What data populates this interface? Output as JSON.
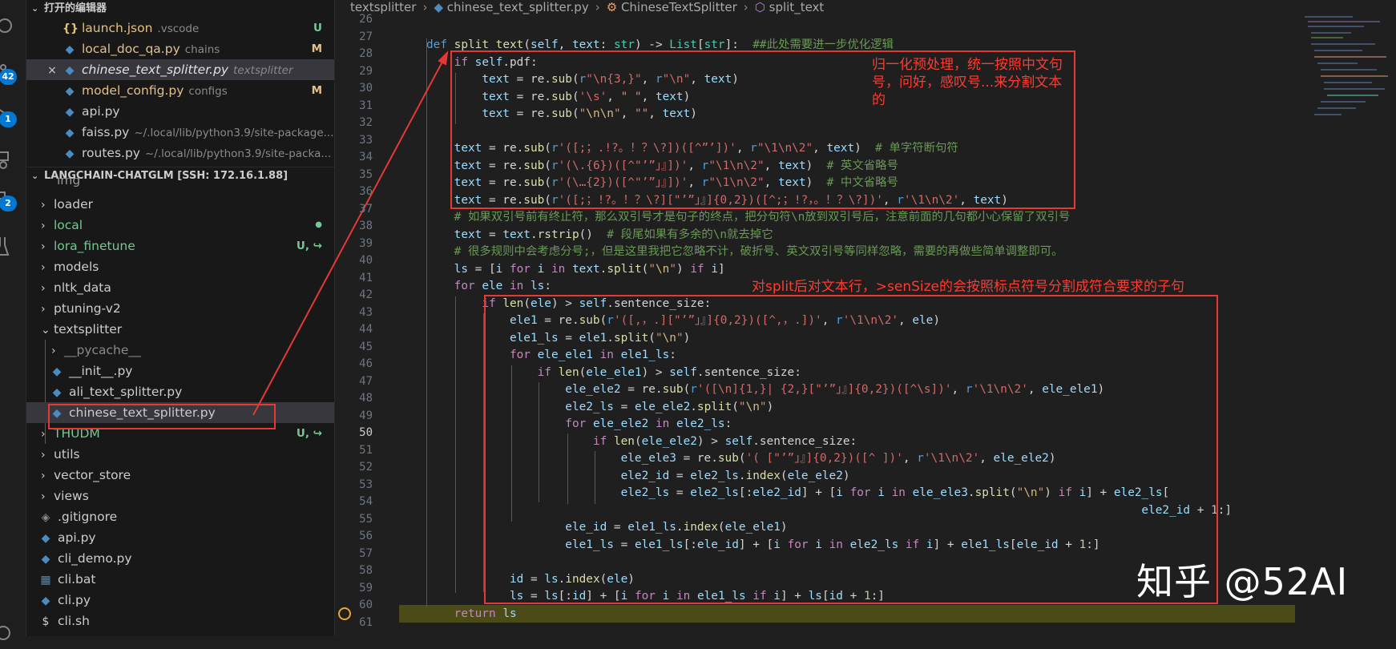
{
  "activity": {
    "badge_scm": "42",
    "badge_run": "1",
    "badge_ext": "2"
  },
  "sidebar": {
    "open_editors_title": "打开的编辑器",
    "open_editors": [
      {
        "name": "launch.json",
        "desc": ".vscode",
        "status": "U",
        "icon": "json-icon"
      },
      {
        "name": "local_doc_qa.py",
        "desc": "chains",
        "status": "M",
        "icon": "python-icon"
      },
      {
        "name": "chinese_text_splitter.py",
        "desc": "textsplitter",
        "status": "",
        "icon": "python-icon"
      },
      {
        "name": "model_config.py",
        "desc": "configs",
        "status": "M",
        "icon": "python-icon"
      },
      {
        "name": "api.py",
        "desc": "",
        "status": "",
        "icon": "python-icon"
      },
      {
        "name": "faiss.py",
        "desc": "~/.local/lib/python3.9/site-package...",
        "status": "",
        "icon": "python-icon"
      },
      {
        "name": "routes.py",
        "desc": "~/.local/lib/python3.9/site-packa...",
        "status": "",
        "icon": "python-icon"
      }
    ],
    "close_icon": "×",
    "explorer_title": "LANGCHAIN-CHATGLM [SSH: 172.16.1.88]",
    "partial_item": "img",
    "tree": [
      {
        "name": "loader",
        "type": "folder",
        "status": ""
      },
      {
        "name": "local",
        "type": "folder",
        "status": "●"
      },
      {
        "name": "lora_finetune",
        "type": "folder",
        "status": "U, ↪"
      },
      {
        "name": "models",
        "type": "folder",
        "status": ""
      },
      {
        "name": "nltk_data",
        "type": "folder",
        "status": ""
      },
      {
        "name": "ptuning-v2",
        "type": "folder",
        "status": ""
      },
      {
        "name": "textsplitter",
        "type": "folder-open",
        "status": ""
      },
      {
        "name": "__pycache__",
        "type": "subfolder",
        "status": ""
      },
      {
        "name": "__init__.py",
        "type": "subfile",
        "status": ""
      },
      {
        "name": "ali_text_splitter.py",
        "type": "subfile",
        "status": ""
      },
      {
        "name": "chinese_text_splitter.py",
        "type": "subfile",
        "status": ""
      },
      {
        "name": "THUDM",
        "type": "folder",
        "status": "U, ↪"
      },
      {
        "name": "utils",
        "type": "folder",
        "status": ""
      },
      {
        "name": "vector_store",
        "type": "folder",
        "status": ""
      },
      {
        "name": "views",
        "type": "folder",
        "status": ""
      },
      {
        "name": ".gitignore",
        "type": "file-git",
        "status": ""
      },
      {
        "name": "api.py",
        "type": "file-py",
        "status": ""
      },
      {
        "name": "cli_demo.py",
        "type": "file-py",
        "status": ""
      },
      {
        "name": "cli.bat",
        "type": "file-bat",
        "status": ""
      },
      {
        "name": "cli.py",
        "type": "file-py",
        "status": ""
      },
      {
        "name": "cli.sh",
        "type": "file-sh",
        "status": ""
      }
    ]
  },
  "breadcrumbs": [
    "textsplitter",
    "chinese_text_splitter.py",
    "ChineseTextSplitter",
    "split_text"
  ],
  "line_numbers": [
    "26",
    "27",
    "28",
    "29",
    "30",
    "31",
    "32",
    "33",
    "34",
    "35",
    "36",
    "37",
    "38",
    "39",
    "40",
    "41",
    "42",
    "43",
    "44",
    "45",
    "46",
    "47",
    "48",
    "49",
    "50",
    "51",
    "52",
    "53",
    "54",
    "55",
    "56",
    "57",
    "58",
    "59",
    "60",
    "61"
  ],
  "current_line": "50",
  "annotations": {
    "box1": "归一化预处理，统一按照中文句号，问好，感叹号...来分割文本的",
    "box2": "对split后对文本行，>senSize的会按照标点符号分割成符合要求的子句"
  },
  "watermark": "知乎 @52AI",
  "colors": {
    "accent": "#0078d4",
    "annotation_red": "#e53935",
    "current_line_bg": "#4b4b18"
  }
}
